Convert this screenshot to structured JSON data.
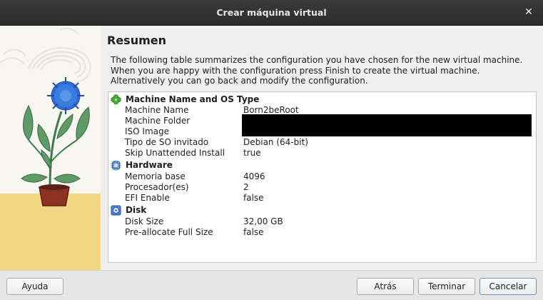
{
  "window": {
    "title": "Crear máquina virtual",
    "close_glyph": "✕"
  },
  "page": {
    "heading": "Resumen",
    "description": [
      "The following table summarizes the configuration you have chosen for the new virtual machine.",
      "When you are happy with the configuration press Finish to create the virtual machine.",
      "Alternatively you can go back and modify the configuration."
    ]
  },
  "summary": {
    "sections": [
      {
        "title": "Machine Name and OS Type",
        "icon": "clover-icon",
        "rows": [
          {
            "key": "Machine Name",
            "value": "Born2beRoot"
          },
          {
            "key": "Machine Folder",
            "value": ""
          },
          {
            "key": "ISO Image",
            "value": ""
          },
          {
            "key": "Tipo de SO invitado",
            "value": "Debian (64-bit)"
          },
          {
            "key": "Skip Unattended Install",
            "value": "true"
          }
        ]
      },
      {
        "title": "Hardware",
        "icon": "chip-icon",
        "rows": [
          {
            "key": "Memoria base",
            "value": "4096"
          },
          {
            "key": "Procesador(es)",
            "value": "2"
          },
          {
            "key": "EFI Enable",
            "value": "false"
          }
        ]
      },
      {
        "title": "Disk",
        "icon": "disk-icon",
        "rows": [
          {
            "key": "Disk Size",
            "value": "32,00 GB"
          },
          {
            "key": "Pre-allocate Full Size",
            "value": "false"
          }
        ]
      }
    ]
  },
  "buttons": {
    "help": "Ayuda",
    "back": "Atrás",
    "finish": "Terminar",
    "cancel": "Cancelar"
  },
  "colors": {
    "titlebar": "#2e2e2e",
    "accent_border": "#6d8fb3",
    "flower_blue": "#2f6bd1"
  }
}
